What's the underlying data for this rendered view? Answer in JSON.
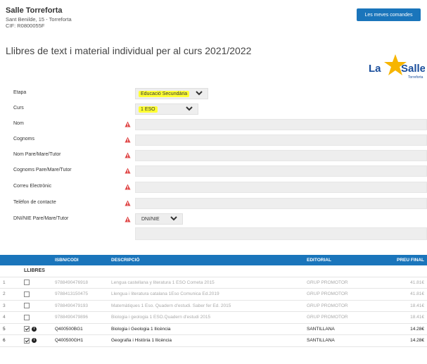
{
  "school": {
    "name": "Salle Torreforta",
    "address": "Sant Benilde, 15 - Torreforta",
    "cif": "CIF: R0800055F"
  },
  "orders_button": "Les meves comandes",
  "title": "Llibres de text i material individual per al curs 2021/2022",
  "logo": {
    "text_la": "La",
    "text_salle": "Salle",
    "text_sub": "Torreforta"
  },
  "form": {
    "etapa_label": "Etapa",
    "etapa_value": "Educació Secundària",
    "curs_label": "Curs",
    "curs_value": "1 ESO",
    "nom_label": "Nom",
    "cognoms_label": "Cognoms",
    "nom_tutor_label": "Nom Pare/Mare/Tutor",
    "cognoms_tutor_label": "Cognoms Pare/Mare/Tutor",
    "email_label": "Correu Electrònic",
    "phone_label": "Telèfon de contacte",
    "dni_label": "DNI/NIE Pare/Mare/Tutor",
    "dni_type": "DNI/NIE"
  },
  "table": {
    "headers": [
      "",
      "",
      "ISBN/CODI",
      "DESCRIPCIÓ",
      "EDITORIAL",
      "PREU FINAL"
    ],
    "section": "LLIBRES",
    "rows": [
      {
        "n": "1",
        "checked": false,
        "code": "9788490476918",
        "desc": "Lengua castellana y literatura 1 ESO Cometa 2015",
        "ed": "GRUP PROMOTOR",
        "price": "41.81€"
      },
      {
        "n": "2",
        "checked": false,
        "code": "9788413150475",
        "desc": "Llengua i literatura catalana 1Eso Comunica Ed.2019",
        "ed": "GRUP PROMOTOR",
        "price": "41.81€"
      },
      {
        "n": "3",
        "checked": false,
        "code": "9788490479193",
        "desc": "Matemàtiques 1 Eso. Quadern d'estudi. Saber fer Ed. 2015",
        "ed": "GRUP PROMOTOR",
        "price": "18.41€"
      },
      {
        "n": "4",
        "checked": false,
        "code": "9788490479896",
        "desc": "Biologia i geologia 1 ESO.Quadern d'estudi 2015",
        "ed": "GRUP PROMOTOR",
        "price": "18.41€"
      },
      {
        "n": "5",
        "checked": true,
        "code": "Q400500BG1",
        "desc": "Biologia i Geologia 1 llicència",
        "ed": "SANTILLANA",
        "price": "14.28€"
      },
      {
        "n": "6",
        "checked": true,
        "code": "Q400500GH1",
        "desc": "Geografia i Història 1 llicència",
        "ed": "SANTILLANA",
        "price": "14.28€"
      }
    ]
  }
}
